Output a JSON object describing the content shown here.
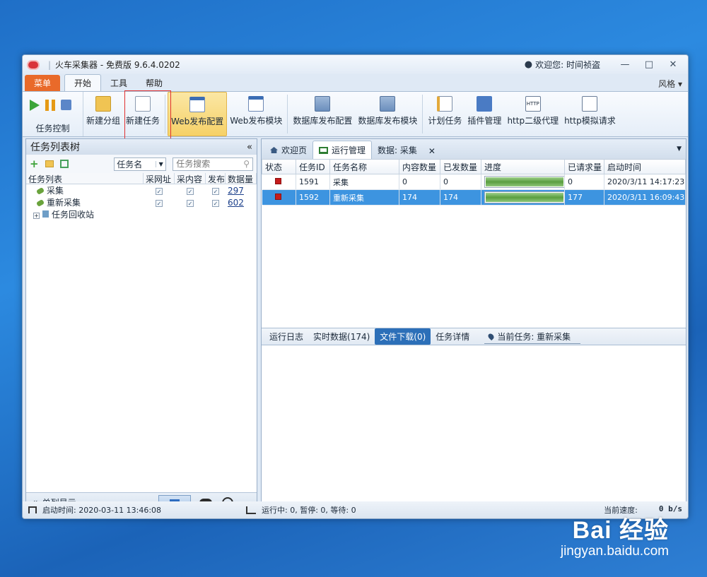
{
  "window": {
    "app_name": "火车采集器",
    "edition": "免费版 9.6.4.0202",
    "separator": "|",
    "welcome": "欢迎您: 时间祯盗",
    "buttons": {
      "minimize": "—",
      "restore": "□",
      "close": "✕"
    }
  },
  "menubar": {
    "main": "菜单",
    "tabs": [
      "开始",
      "工具",
      "帮助"
    ],
    "style": "风格 ▾"
  },
  "ribbon": {
    "control_group": "任务控制",
    "buttons": [
      "新建分组",
      "新建任务",
      "Web发布配置",
      "Web发布模块",
      "数据库发布配置",
      "数据库发布模块",
      "计划任务",
      "插件管理",
      "http二级代理",
      "http模拟请求"
    ],
    "http_icon_text": "HTTP"
  },
  "left_panel": {
    "title": "任务列表树",
    "collapse": "«",
    "sort_select": "任务名",
    "search_placeholder": "任务搜索",
    "columns": [
      "任务列表",
      "采网址",
      "采内容",
      "发布",
      "数据量"
    ],
    "tasks": [
      {
        "name": "采集",
        "count": "297"
      },
      {
        "name": "重新采集",
        "count": "602"
      }
    ],
    "recycle": "任务回收站",
    "footer": "单列显示"
  },
  "right_panel": {
    "tabs": [
      "欢迎页",
      "运行管理",
      "数据: 采集"
    ],
    "close_tab": "✕",
    "columns": [
      "状态",
      "任务ID",
      "任务名称",
      "内容数量",
      "已发数量",
      "进度",
      "已请求量",
      "启动时间"
    ],
    "rows": [
      {
        "id": "1591",
        "name": "采集",
        "content": "0",
        "published": "0",
        "progress": 1.0,
        "requested": "0",
        "start": "2020/3/11 14:17:23"
      },
      {
        "id": "1592",
        "name": "重新采集",
        "content": "174",
        "published": "174",
        "progress": 1.0,
        "requested": "177",
        "start": "2020/3/11 16:09:43"
      }
    ],
    "bottom_tabs": [
      "运行日志",
      "实时数据(174)",
      "文件下载(0)",
      "任务详情"
    ],
    "current_task": "当前任务: 重新采集"
  },
  "statusbar": {
    "start_time": "启动时间: 2020-03-11 13:46:08",
    "run_stats": "运行中: 0, 暂停: 0, 等待: 0",
    "speed_label": "当前速度:",
    "speed_value": "0 b/s"
  },
  "watermark": {
    "main": "Bai 经验",
    "sub": "jingyan.baidu.com"
  },
  "colors": {
    "menu_main": "#e96a2a",
    "selected_row": "#3d94e0",
    "highlight_box": "#e03030",
    "status_stopped": "#c51c1c"
  }
}
